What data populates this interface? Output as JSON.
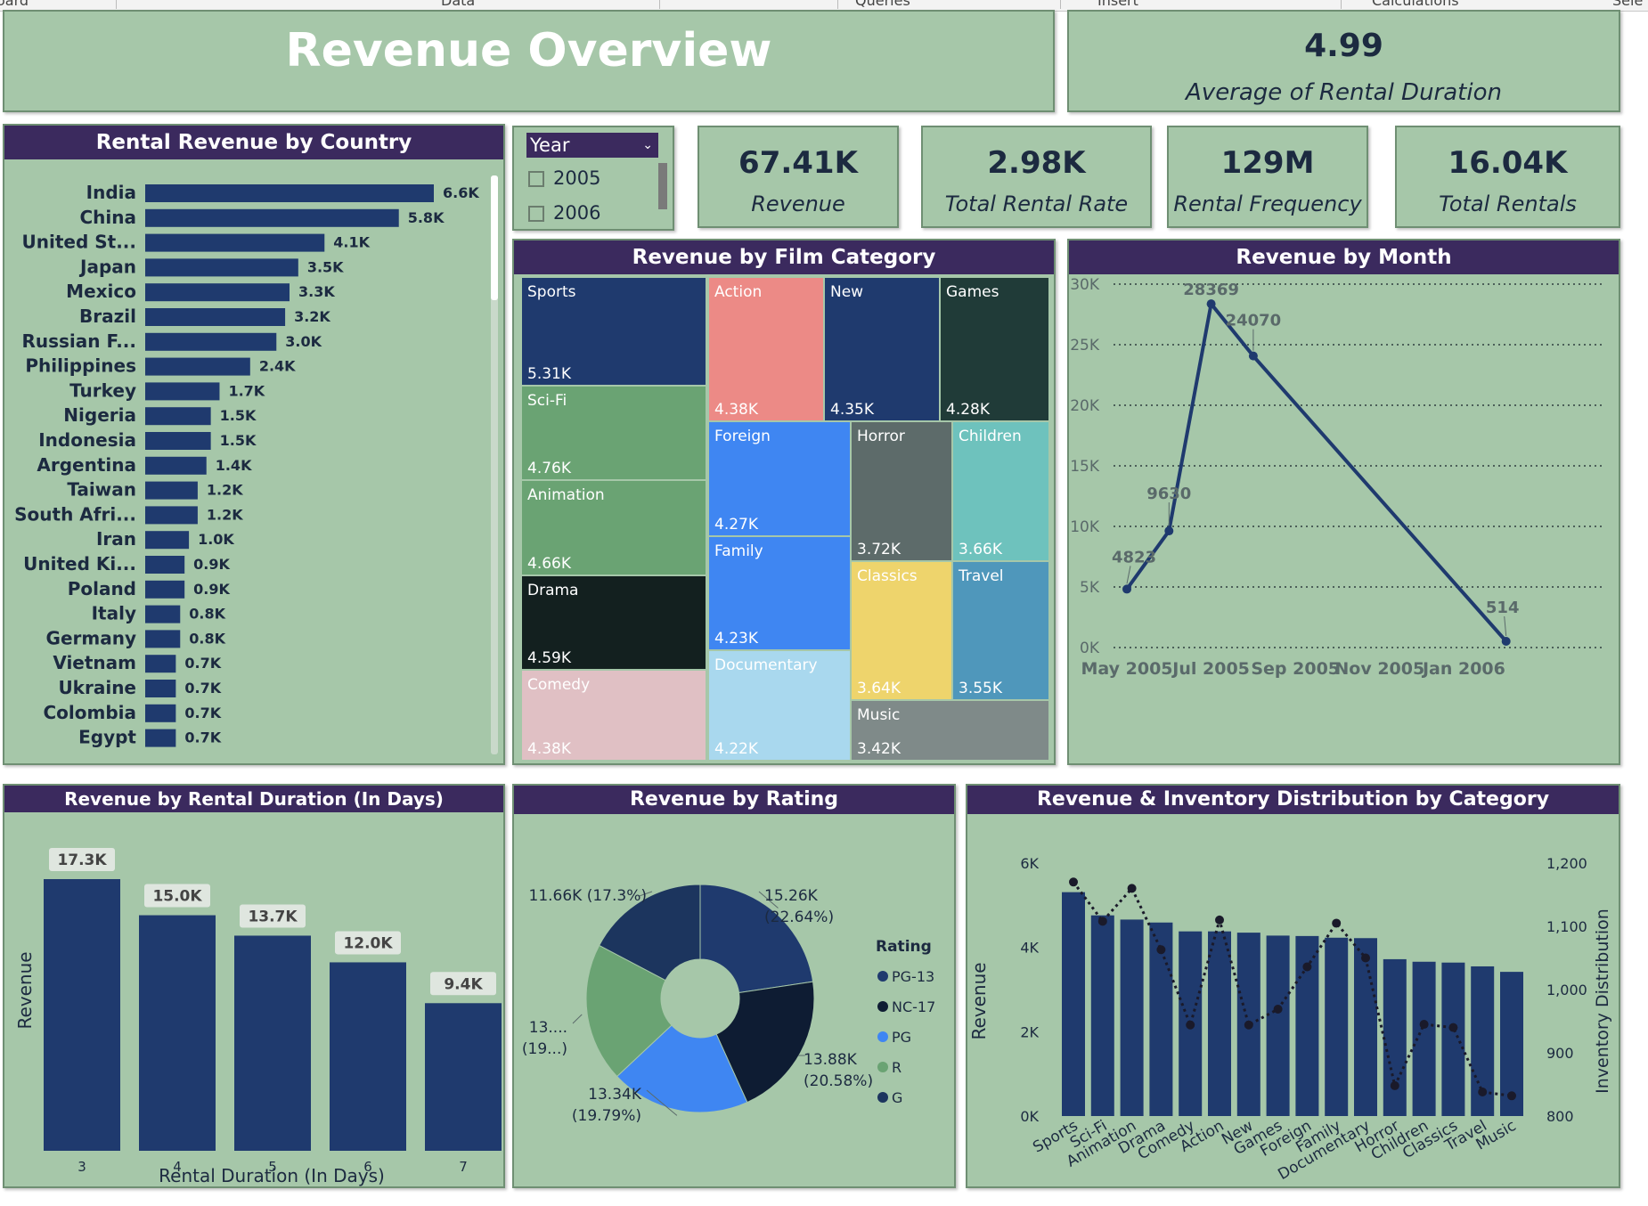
{
  "menubar": {
    "items": [
      "oard",
      "Data",
      "Queries",
      "Insert",
      "Calculations",
      "Sele"
    ]
  },
  "title": "Revenue Overview",
  "kpis": {
    "avg_rental_duration": {
      "value": "4.99",
      "label": "Average of Rental Duration"
    },
    "revenue": {
      "value": "67.41K",
      "label": "Revenue"
    },
    "total_rental_rate": {
      "value": "2.98K",
      "label": "Total Rental Rate"
    },
    "rental_frequency": {
      "value": "129M",
      "label": "Rental Frequency"
    },
    "total_rentals": {
      "value": "16.04K",
      "label": "Total Rentals"
    }
  },
  "year_slicer": {
    "title": "Year",
    "options": [
      "2005",
      "2006"
    ]
  },
  "colors": {
    "panel": "#a6c7a9",
    "header": "#3b2a5e",
    "bar": "#1f3a6e",
    "text": "#1c2a40",
    "line": "#1f3a6e"
  },
  "chart_data": [
    {
      "type": "bar",
      "orientation": "horizontal",
      "title": "Rental Revenue by Country",
      "categories": [
        "India",
        "China",
        "United St...",
        "Japan",
        "Mexico",
        "Brazil",
        "Russian F...",
        "Philippines",
        "Turkey",
        "Nigeria",
        "Indonesia",
        "Argentina",
        "Taiwan",
        "South Afri...",
        "Iran",
        "United Ki...",
        "Poland",
        "Italy",
        "Germany",
        "Vietnam",
        "Ukraine",
        "Colombia",
        "Egypt"
      ],
      "values": [
        6.6,
        5.8,
        4.1,
        3.5,
        3.3,
        3.2,
        3.0,
        2.4,
        1.7,
        1.5,
        1.5,
        1.4,
        1.2,
        1.2,
        1.0,
        0.9,
        0.9,
        0.8,
        0.8,
        0.7,
        0.7,
        0.7,
        0.7
      ],
      "labels": [
        "6.6K",
        "5.8K",
        "4.1K",
        "3.5K",
        "3.3K",
        "3.2K",
        "3.0K",
        "2.4K",
        "1.7K",
        "1.5K",
        "1.5K",
        "1.4K",
        "1.2K",
        "1.2K",
        "1.0K",
        "0.9K",
        "0.9K",
        "0.8K",
        "0.8K",
        "0.7K",
        "0.7K",
        "0.7K",
        "0.7K"
      ]
    },
    {
      "type": "treemap",
      "title": "Revenue by Film Category",
      "items": [
        {
          "name": "Sports",
          "value": "5.31K",
          "color": "#1f3a6e"
        },
        {
          "name": "Sci-Fi",
          "value": "4.76K",
          "color": "#6aa373"
        },
        {
          "name": "Animation",
          "value": "4.66K",
          "color": "#6aa373"
        },
        {
          "name": "Drama",
          "value": "4.59K",
          "color": "#13201f"
        },
        {
          "name": "Comedy",
          "value": "4.38K",
          "color": "#e0c0c4"
        },
        {
          "name": "Action",
          "value": "4.38K",
          "color": "#ec8a86"
        },
        {
          "name": "New",
          "value": "4.35K",
          "color": "#1f3a6e"
        },
        {
          "name": "Games",
          "value": "4.28K",
          "color": "#203b38"
        },
        {
          "name": "Foreign",
          "value": "4.27K",
          "color": "#3f86f2"
        },
        {
          "name": "Family",
          "value": "4.23K",
          "color": "#3f86f2"
        },
        {
          "name": "Documentary",
          "value": "4.22K",
          "color": "#a9d8ee"
        },
        {
          "name": "Horror",
          "value": "3.72K",
          "color": "#5d6b6a"
        },
        {
          "name": "Children",
          "value": "3.66K",
          "color": "#6ec2bd"
        },
        {
          "name": "Classics",
          "value": "3.64K",
          "color": "#eed46c"
        },
        {
          "name": "Travel",
          "value": "3.55K",
          "color": "#4f97bb"
        },
        {
          "name": "Music",
          "value": "3.42K",
          "color": "#7f8a89"
        }
      ]
    },
    {
      "type": "line",
      "title": "Revenue by Month",
      "x": [
        "May 2005",
        "Jun 2005",
        "Jul 2005",
        "Aug 2005",
        "Feb 2006"
      ],
      "y": [
        4823,
        9630,
        28369,
        24070,
        514
      ],
      "point_labels": [
        "4823",
        "9630",
        "28369",
        "24070",
        "514"
      ],
      "xticks": [
        "May 2005",
        "Jul 2005",
        "Sep 2005",
        "Nov 2005",
        "Jan 2006"
      ],
      "yticks": [
        "0K",
        "5K",
        "10K",
        "15K",
        "20K",
        "25K",
        "30K"
      ],
      "ylim": [
        0,
        30000
      ],
      "grid": true
    },
    {
      "type": "bar",
      "title": "Revenue by Rental Duration (In Days)",
      "categories": [
        "3",
        "4",
        "5",
        "6",
        "7"
      ],
      "values": [
        17.3,
        15.0,
        13.7,
        12.0,
        9.4
      ],
      "labels": [
        "17.3K",
        "15.0K",
        "13.7K",
        "12.0K",
        "9.4K"
      ],
      "xlabel": "Rental Duration (In Days)",
      "ylabel": "Revenue"
    },
    {
      "type": "pie",
      "donut": true,
      "title": "Revenue by Rating",
      "legend_title": "Rating",
      "slices": [
        {
          "name": "PG-13",
          "value": 15.26,
          "label": "15.26K",
          "pct": "(22.64%)",
          "color": "#1f3a6e"
        },
        {
          "name": "NC-17",
          "value": 13.88,
          "label": "13.88K",
          "pct": "(20.58%)",
          "color": "#0e1c33"
        },
        {
          "name": "PG",
          "value": 13.34,
          "label": "13.34K",
          "pct": "(19.79%)",
          "color": "#3f86f2"
        },
        {
          "name": "R",
          "value": 13.27,
          "label": "13....",
          "pct": "(19...)",
          "color": "#6aa373"
        },
        {
          "name": "G",
          "value": 11.66,
          "label": "11.66K",
          "pct": "(17.3%)",
          "color": "#1c355e"
        }
      ],
      "legend_position": "right"
    },
    {
      "type": "bar+line",
      "title": "Revenue & Inventory Distribution by Category",
      "categories": [
        "Sports",
        "Sci-Fi",
        "Animation",
        "Drama",
        "Comedy",
        "Action",
        "New",
        "Games",
        "Foreign",
        "Family",
        "Documentary",
        "Horror",
        "Children",
        "Classics",
        "Travel",
        "Music"
      ],
      "bar_series": {
        "name": "Revenue",
        "values": [
          5.31,
          4.76,
          4.66,
          4.59,
          4.38,
          4.38,
          4.35,
          4.28,
          4.27,
          4.23,
          4.22,
          3.72,
          3.66,
          3.64,
          3.55,
          3.42
        ]
      },
      "line_series": {
        "name": "Inventory Distribution",
        "values": [
          1170,
          1108,
          1160,
          1063,
          944,
          1110,
          944,
          969,
          1036,
          1105,
          1050,
          848,
          945,
          940,
          838,
          832
        ]
      },
      "ylabel_left": "Revenue",
      "ylabel_right": "Inventory Distribution",
      "yticks_left": [
        "0K",
        "2K",
        "4K",
        "6K"
      ],
      "yticks_right": [
        "800",
        "900",
        "1,000",
        "1,100",
        "1,200"
      ],
      "ylim_left": [
        0,
        6000
      ],
      "ylim_right": [
        800,
        1200
      ]
    }
  ]
}
